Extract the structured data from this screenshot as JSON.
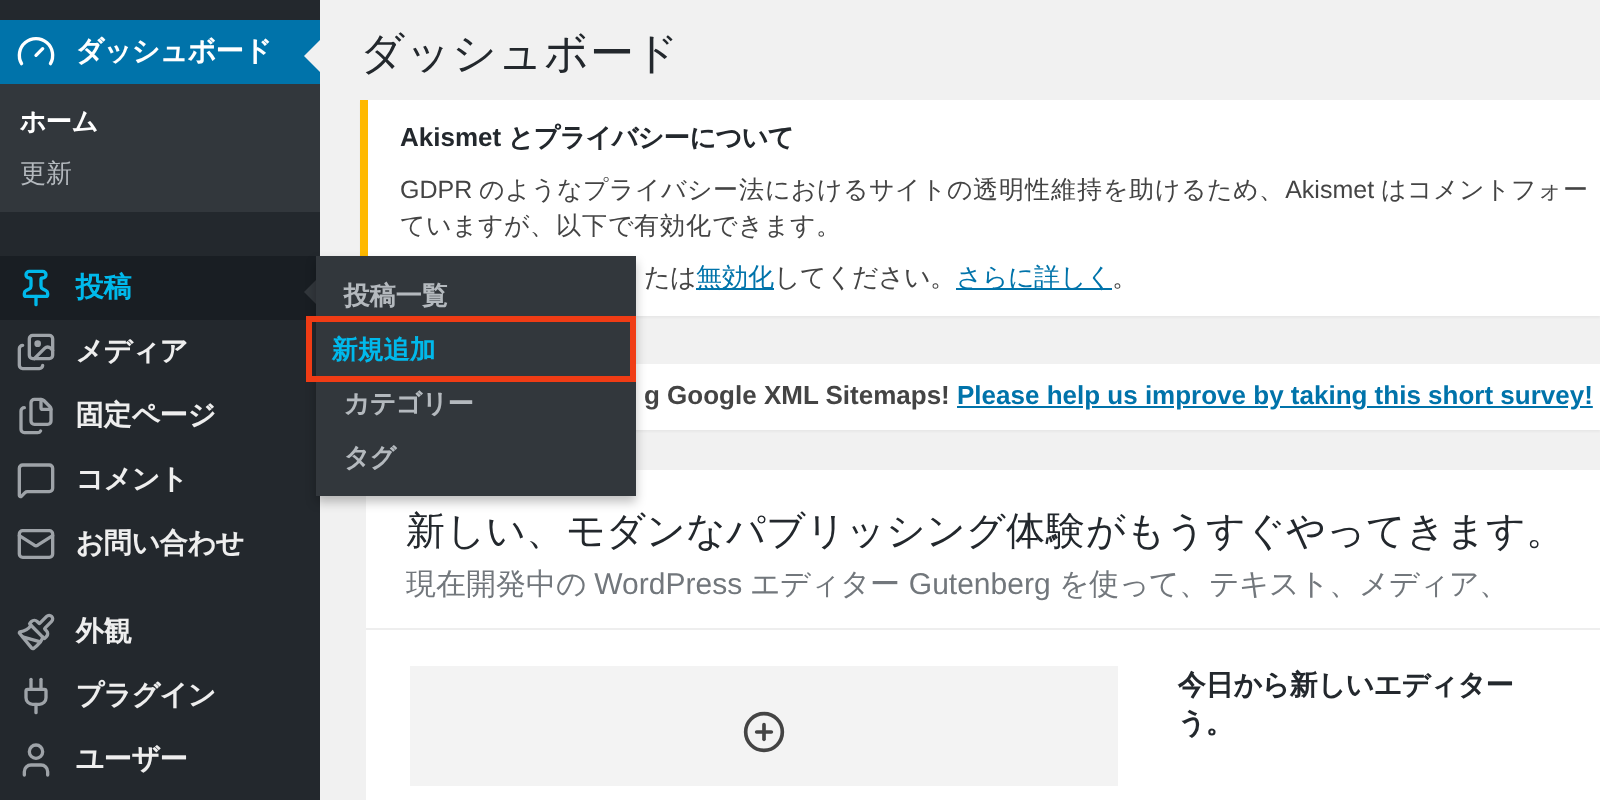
{
  "sidebar": {
    "groups": [
      [
        {
          "label": "ダッシュボード",
          "selected": true,
          "submenu": [
            {
              "label": "ホーム",
              "selected": true
            },
            {
              "label": "更新",
              "selected": false
            }
          ]
        }
      ],
      [
        {
          "label": "投稿",
          "selected": false,
          "hovered": true,
          "flyout": [
            {
              "label": "投稿一覧",
              "highlighted": false
            },
            {
              "label": "新規追加",
              "highlighted": true
            },
            {
              "label": "カテゴリー",
              "highlighted": false
            },
            {
              "label": "タグ",
              "highlighted": false
            }
          ]
        },
        {
          "label": "メディア",
          "selected": false
        },
        {
          "label": "固定ページ",
          "selected": false
        },
        {
          "label": "コメント",
          "selected": false
        },
        {
          "label": "お問い合わせ",
          "selected": false
        }
      ],
      [
        {
          "label": "外観",
          "selected": false
        },
        {
          "label": "プラグイン",
          "selected": false
        },
        {
          "label": "ユーザー",
          "selected": false
        }
      ]
    ]
  },
  "page_title": "ダッシュボード",
  "notices": [
    {
      "title": "Akismet とプライバシーについて",
      "lines": [
        "GDPR のようなプライバシー法におけるサイトの透明性維持を助けるため、Akismet はコメントフォー",
        "ていますが、以下で有効化できます。"
      ],
      "footer": {
        "before": "たは",
        "link": "無効化",
        "middle": "してください。",
        "link2": "さらに詳しく",
        "after": "。"
      }
    },
    {
      "text": "g Google XML Sitemaps! ",
      "link": "Please help us improve by taking this short survey!"
    }
  ],
  "welcome": {
    "heading": "新しい、モダンなパブリッシング体験がもうすぐやってきます。",
    "subtitle": "現在開発中の WordPress エディター Gutenberg を使って、テキスト、メディア、",
    "side_lines": [
      "今日から新しいエディター",
      "う。"
    ]
  }
}
